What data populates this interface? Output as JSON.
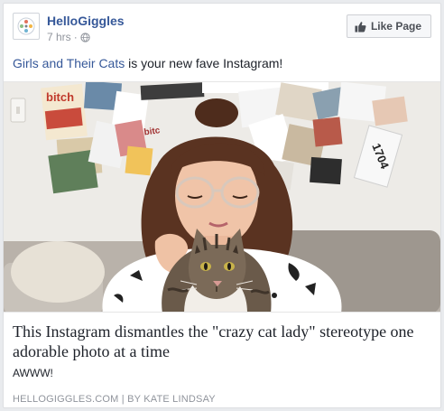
{
  "post": {
    "page_name": "HelloGiggles",
    "timestamp": "7 hrs",
    "separator": "·",
    "like_button_label": "Like Page",
    "text_link": "Girls and Their Cats",
    "text_rest": " is your new fave Instagram!",
    "image_sign_text_1": "bitch",
    "image_sign_text_2": "1704",
    "image_sign_text_3": "bitc",
    "link_title": "This Instagram dismantles the \"crazy cat lady\" stereotype one adorable photo at a time",
    "link_description": "AWWW!",
    "link_footer": "HELLOGIGGLES.COM | BY KATE LINDSAY"
  },
  "icons": {
    "avatar": "hellogiggles-logo-icon",
    "privacy": "globe-icon",
    "like": "thumbs-up-icon"
  },
  "colors": {
    "link_blue": "#365899",
    "meta_gray": "#90949c",
    "button_bg": "#f6f7f9"
  }
}
